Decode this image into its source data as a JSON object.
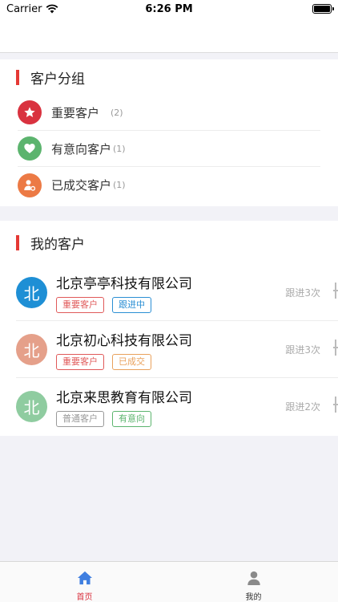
{
  "status": {
    "carrier": "Carrier",
    "time": "6:26 PM"
  },
  "groups": {
    "title": "客户分组",
    "items": [
      {
        "label": "重要客户",
        "count": "(2)",
        "icon": "star-icon",
        "color": "#d9323f"
      },
      {
        "label": "有意向客户",
        "count": "(1)",
        "icon": "heart-icon",
        "color": "#5cb46e"
      },
      {
        "label": "已成交客户",
        "count": "(1)",
        "icon": "user-deal-icon",
        "color": "#ec7a45"
      }
    ]
  },
  "customers": {
    "title": "我的客户",
    "items": [
      {
        "avatar": "北",
        "avatar_color": "#1e8fd5",
        "name": "北京亭亭科技有限公司",
        "followup": "跟进3次",
        "tags": [
          {
            "text": "重要客户",
            "color": "#e05a5a"
          },
          {
            "text": "跟进中",
            "color": "#2b8fd4"
          }
        ]
      },
      {
        "avatar": "北",
        "avatar_color": "#e5a08a",
        "name": "北京初心科技有限公司",
        "followup": "跟进3次",
        "tags": [
          {
            "text": "重要客户",
            "color": "#e05a5a"
          },
          {
            "text": "已成交",
            "color": "#e9a15c"
          }
        ]
      },
      {
        "avatar": "北",
        "avatar_color": "#8fcca0",
        "name": "北京来思教育有限公司",
        "followup": "跟进2次",
        "tags": [
          {
            "text": "普通客户",
            "color": "#999999"
          },
          {
            "text": "有意向",
            "color": "#5cb46e"
          }
        ]
      }
    ]
  },
  "tabbar": {
    "home": {
      "label": "首页",
      "icon": "home-icon",
      "color": "#d9323f",
      "icon_color": "#3f7fe0"
    },
    "mine": {
      "label": "我的",
      "icon": "person-icon",
      "color": "#333333",
      "icon_color": "#8a8a8a"
    }
  }
}
